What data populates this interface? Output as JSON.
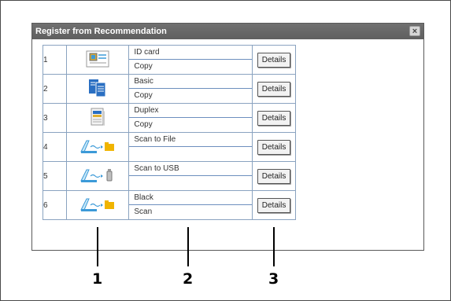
{
  "dialog": {
    "title": "Register from Recommendation",
    "close_label": "×"
  },
  "rows": [
    {
      "num": "1",
      "icon": "id-card-copy-icon",
      "line1": "ID card",
      "line2": "Copy",
      "button": "Details"
    },
    {
      "num": "2",
      "icon": "basic-copy-icon",
      "line1": "Basic",
      "line2": "Copy",
      "button": "Details"
    },
    {
      "num": "3",
      "icon": "duplex-copy-icon",
      "line1": "Duplex",
      "line2": "Copy",
      "button": "Details"
    },
    {
      "num": "4",
      "icon": "scan-to-file-icon",
      "line1": "Scan to File",
      "line2": "",
      "button": "Details"
    },
    {
      "num": "5",
      "icon": "scan-to-usb-icon",
      "line1": "Scan to USB",
      "line2": "",
      "button": "Details"
    },
    {
      "num": "6",
      "icon": "black-scan-icon",
      "line1": "Black",
      "line2": "Scan",
      "button": "Details"
    }
  ],
  "callouts": [
    "1",
    "2",
    "3"
  ]
}
